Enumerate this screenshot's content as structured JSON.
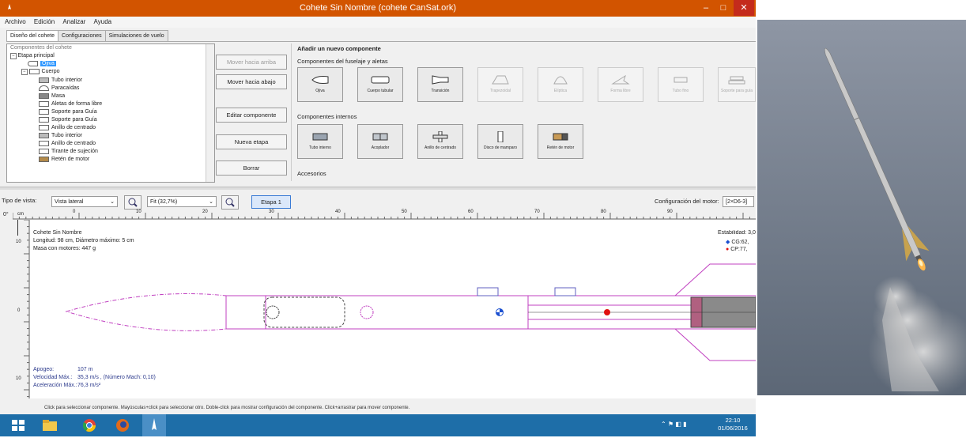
{
  "window": {
    "title": "Cohete Sin Nombre (cohete CanSat.ork)",
    "controls": {
      "minimize": "–",
      "maximize": "□",
      "close": "✕"
    }
  },
  "menu": [
    "Archivo",
    "Edición",
    "Analizar",
    "Ayuda"
  ],
  "tabs": [
    "Diseño del cohete",
    "Configuraciones",
    "Simulaciones de vuelo"
  ],
  "tree": {
    "header": "Componentes del cohete",
    "items": [
      {
        "label": "Etapa principal"
      },
      {
        "label": "Ojiva"
      },
      {
        "label": "Cuerpo"
      },
      {
        "label": "Tubo interior"
      },
      {
        "label": "Paracaídas"
      },
      {
        "label": "Masa"
      },
      {
        "label": "Aletas de forma libre"
      },
      {
        "label": "Soporte para Guía"
      },
      {
        "label": "Soporte para Guía"
      },
      {
        "label": "Anillo de centrado"
      },
      {
        "label": "Tubo interior"
      },
      {
        "label": "Anillo de centrado"
      },
      {
        "label": "Tirante de sujeción"
      },
      {
        "label": "Retén de motor"
      }
    ]
  },
  "actions": {
    "move_up": "Mover hacia arriba",
    "move_down": "Mover hacia abajo",
    "edit": "Editar componente",
    "new_stage": "Nueva etapa",
    "delete": "Borrar"
  },
  "add_panel": {
    "title": "Añadir un nuevo componente",
    "fuselage_title": "Componentes del fuselaje y aletas",
    "fuselage": [
      "Ojiva",
      "Cuerpo tubular",
      "Transición",
      "Trapezoidal",
      "Elíptica",
      "Forma libre",
      "Tubo fino",
      "Soporte para guía"
    ],
    "internal_title": "Componentes internos",
    "internal": [
      "Tubo interno",
      "Acoplador",
      "Anillo de centrado",
      "Disco de mamparo",
      "Retén de motor"
    ],
    "accessories_title": "Accesorios"
  },
  "view": {
    "type_label": "Tipo de vista:",
    "type_value": "Vista lateral",
    "zoom_value": "Fit (32,7%)",
    "stage_button": "Etapa 1",
    "motor_config_label": "Configuración del motor:",
    "motor_config_value": "[2×D6-3]"
  },
  "ruler": {
    "angle": "0°",
    "unit": "cm",
    "ticks": [
      "0",
      "10",
      "20",
      "30",
      "40",
      "50",
      "60",
      "70",
      "80",
      "90"
    ],
    "vticks": [
      "10",
      "0",
      "10"
    ]
  },
  "info": {
    "name": "Cohete Sin Nombre",
    "length": "Longitud: 98 cm, Diámetro máximo: 5 cm",
    "mass": "Masa con motores: 447 g",
    "stability": "Estabilidad: 3,0",
    "cg": "CG:62,",
    "cp": "CP:77,",
    "apogee_label": "Apogeo:",
    "apogee_value": "107 m",
    "vmax_label": "Velocidad Máx.:",
    "vmax_value": "35,3 m/s  , (Número Mach: 0,10)",
    "amax_label": "Aceleración Máx.:",
    "amax_value": "76,3 m/s²"
  },
  "status": "Click para seleccionar componente.   Mayúsculas+click para seleccionar otro.   Doble-click para mostrar configuración del componente.   Click+arrastrar para mover componente.",
  "taskbar": {
    "time": "22:10",
    "date": "01/06/2016",
    "icons": [
      "windows-start",
      "file-explorer",
      "chrome",
      "firefox",
      "openrocket"
    ]
  },
  "colors": {
    "titlebar": "#d25400",
    "taskbar": "#1e6ea8",
    "selection": "#3399ff",
    "rocket_outline": "#c040c0",
    "cg_color": "#1a4fd0",
    "cp_color": "#e01010"
  }
}
